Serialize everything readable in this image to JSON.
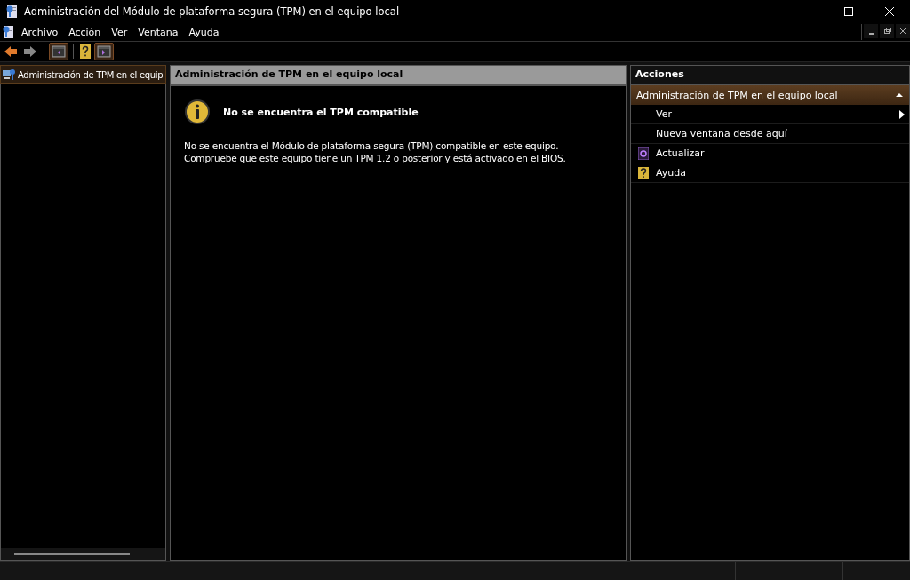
{
  "window": {
    "title": "Administración del Módulo de plataforma segura (TPM) en el equipo local"
  },
  "menu": [
    "Archivo",
    "Acción",
    "Ver",
    "Ventana",
    "Ayuda"
  ],
  "tree": {
    "items": [
      {
        "label": "Administración de TPM en el equip",
        "selected": true
      }
    ]
  },
  "content": {
    "header": "Administración de TPM en el equipo local",
    "message_title": "No se encuentra el TPM compatible",
    "message": "No se encuentra el Módulo de plataforma segura (TPM) compatible en este equipo. Compruebe que este equipo tiene un TPM 1.2 o posterior y está activado en el BIOS."
  },
  "actions": {
    "title": "Acciones",
    "group": {
      "label": "Administración de TPM en el equipo local",
      "expanded": true
    },
    "items": [
      {
        "label": "Ver",
        "kind": "submenu"
      },
      {
        "label": "Nueva ventana desde aquí",
        "kind": "plain"
      },
      {
        "label": "Actualizar",
        "kind": "refresh"
      },
      {
        "label": "Ayuda",
        "kind": "help"
      }
    ]
  }
}
